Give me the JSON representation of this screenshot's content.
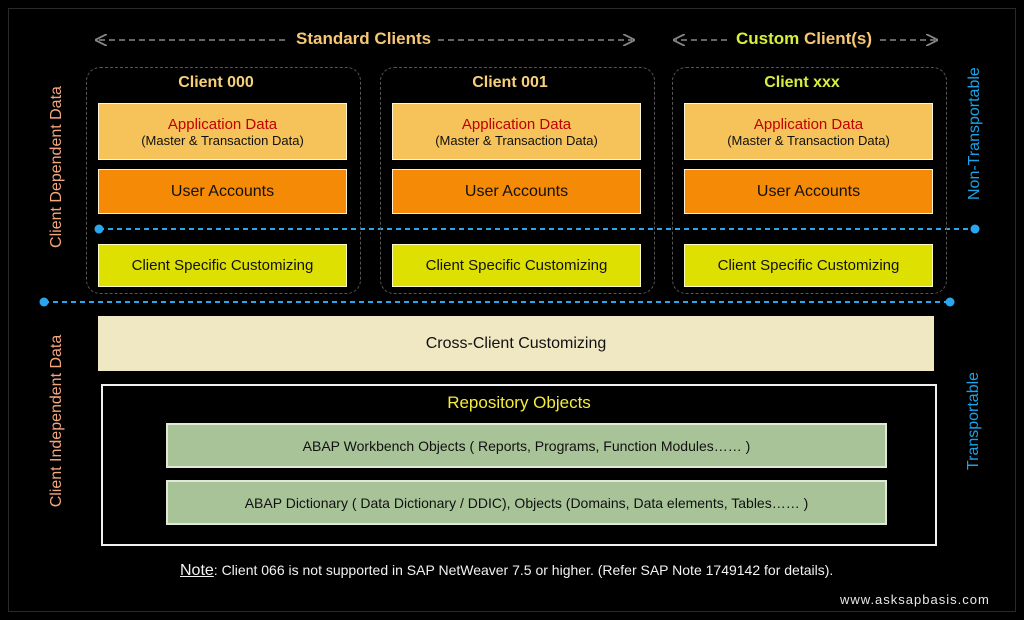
{
  "header": {
    "standard_word1": "Standard",
    "standard_word2": "Clients",
    "custom_word1": "Custom",
    "custom_word2": "Client(s)"
  },
  "side_labels": {
    "client_dependent": "Client Dependent Data",
    "client_independent": "Client Independent Data",
    "non_transportable": "Non-Transportable",
    "transportable": "Transportable"
  },
  "clients": [
    {
      "name": "Client 000",
      "app_data": "Application Data",
      "app_data_sub": "(Master & Transaction Data)",
      "user_accounts": "User Accounts",
      "customizing": "Client Specific Customizing"
    },
    {
      "name": "Client 001",
      "app_data": "Application Data",
      "app_data_sub": "(Master & Transaction Data)",
      "user_accounts": "User Accounts",
      "customizing": "Client Specific Customizing"
    },
    {
      "name": "Client xxx",
      "app_data": "Application Data",
      "app_data_sub": "(Master & Transaction Data)",
      "user_accounts": "User Accounts",
      "customizing": "Client Specific Customizing"
    }
  ],
  "cross_client": "Cross-Client Customizing",
  "repository": {
    "title": "Repository Objects",
    "workbench": "ABAP Workbench Objects ( Reports, Programs, Function Modules…… )",
    "dictionary": "ABAP Dictionary ( Data Dictionary / DDIC), Objects (Domains, Data elements, Tables…… )"
  },
  "note": {
    "label": "Note",
    "text": ": Client 066 is not supported in SAP NetWeaver 7.5 or higher. (Refer SAP Note 1749142 for details)."
  },
  "website": "www.asksapbasis.com",
  "colors": {
    "standard_header": "#f7c873",
    "custom_header": "#d8ef3c",
    "client_title_std": "#f7d17a",
    "client_title_custom": "#d8ef3c",
    "dependent_label": "#f3a77e",
    "transport_label": "#1aa3e8",
    "dashed_line": "#2aa6ee"
  }
}
